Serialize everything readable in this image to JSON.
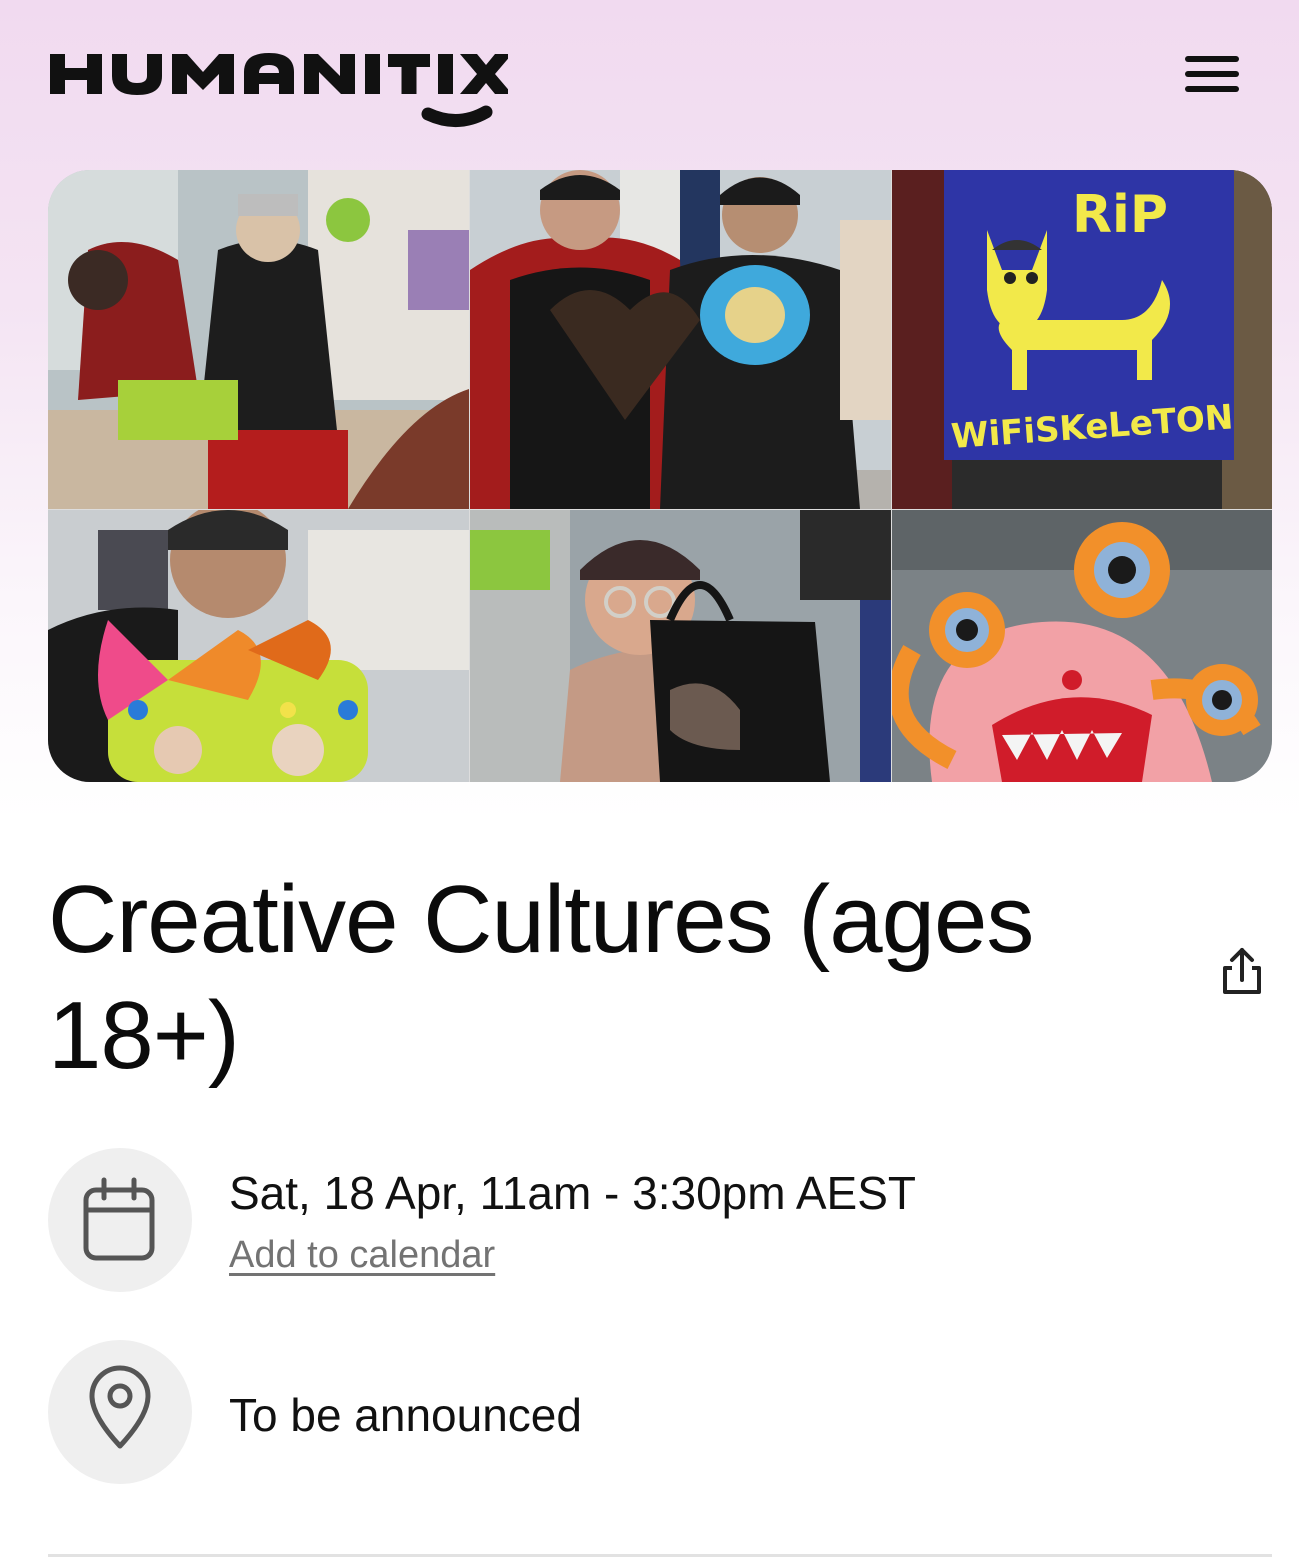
{
  "header": {
    "logo_text": "HUMANITIX",
    "menu_icon": "hamburger-icon"
  },
  "gallery": {
    "photos": [
      "craft table with people working on projects",
      "two people holding decorated heart collages",
      "blue felt banner with yellow cat",
      "person holding butterfly photo frame",
      "person holding black tote bag",
      "pink felt monster with orange eyes"
    ],
    "banner_text": [
      "RiP",
      "WiFiSKeLeTON"
    ]
  },
  "event": {
    "title": "Creative Cultures (ages 18+)",
    "date_time": "Sat, 18 Apr, 11am - 3:30pm AEST",
    "add_to_calendar": "Add to calendar",
    "location": "To be announced"
  },
  "icons": {
    "share": "share-icon",
    "calendar": "calendar-icon",
    "location": "location-pin-icon"
  },
  "colors": {
    "header_gradient_top": "#f1daf0",
    "text": "#111111",
    "link": "#737373",
    "icon_circle": "#efefef"
  }
}
